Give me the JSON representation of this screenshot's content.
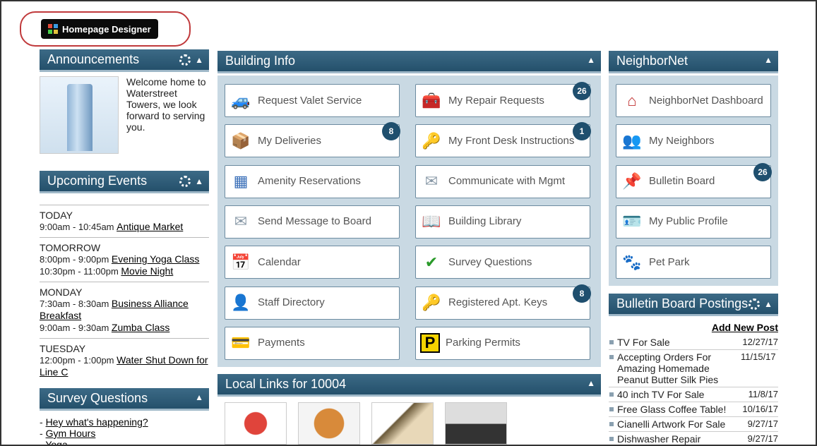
{
  "header": {
    "designer_button": "Homepage Designer"
  },
  "announcements": {
    "title": "Announcements",
    "text": "Welcome home to Waterstreet Towers, we look forward to serving you."
  },
  "events": {
    "title": "Upcoming Events",
    "days": [
      {
        "day": "TODAY",
        "items": [
          {
            "time": "9:00am - 10:45am",
            "name": "Antique Market"
          }
        ]
      },
      {
        "day": "TOMORROW",
        "items": [
          {
            "time": "8:00pm - 9:00pm",
            "name": "Evening Yoga Class"
          },
          {
            "time": "10:30pm - 11:00pm",
            "name": "Movie Night"
          }
        ]
      },
      {
        "day": "MONDAY",
        "items": [
          {
            "time": "7:30am - 8:30am",
            "name": "Business Alliance Breakfast"
          },
          {
            "time": "9:00am - 9:30am",
            "name": "Zumba Class"
          }
        ]
      },
      {
        "day": "TUESDAY",
        "items": [
          {
            "time": "12:00pm - 1:00pm",
            "name": "Water Shut Down for Line C"
          }
        ]
      }
    ]
  },
  "survey": {
    "title": "Survey Questions",
    "items": [
      "Hey what's happening?",
      "Gym Hours",
      "Yoga"
    ]
  },
  "building": {
    "title": "Building Info",
    "tiles": [
      {
        "label": "Request Valet Service",
        "icon": "car-icon",
        "badge": ""
      },
      {
        "label": "My Repair Requests",
        "icon": "toolbox-icon",
        "badge": "26"
      },
      {
        "label": "My Deliveries",
        "icon": "package-icon",
        "badge": "8"
      },
      {
        "label": "My Front Desk Instructions",
        "icon": "key-icon",
        "badge": "1"
      },
      {
        "label": "Amenity Reservations",
        "icon": "calendar-grid-icon",
        "badge": ""
      },
      {
        "label": "Communicate with Mgmt",
        "icon": "envelope-icon",
        "badge": ""
      },
      {
        "label": "Send Message to Board",
        "icon": "envelope-icon",
        "badge": ""
      },
      {
        "label": "Building Library",
        "icon": "book-icon",
        "badge": ""
      },
      {
        "label": "Calendar",
        "icon": "calendar-icon",
        "badge": ""
      },
      {
        "label": "Survey Questions",
        "icon": "checkmark-icon",
        "badge": ""
      },
      {
        "label": "Staff Directory",
        "icon": "person-icon",
        "badge": ""
      },
      {
        "label": "Registered Apt. Keys",
        "icon": "key-icon",
        "badge": "8"
      },
      {
        "label": "Payments",
        "icon": "credit-card-icon",
        "badge": ""
      },
      {
        "label": "Parking Permits",
        "icon": "parking-icon",
        "badge": ""
      }
    ]
  },
  "locallinks": {
    "title": "Local Links for 10004"
  },
  "neighbornet": {
    "title": "NeighborNet",
    "tiles": [
      {
        "label": "NeighborNet Dashboard",
        "icon": "house-icon",
        "badge": ""
      },
      {
        "label": "My Neighbors",
        "icon": "people-icon",
        "badge": ""
      },
      {
        "label": "Bulletin Board",
        "icon": "pushpin-icon",
        "badge": "26"
      },
      {
        "label": "My Public Profile",
        "icon": "profile-card-icon",
        "badge": ""
      },
      {
        "label": "Pet Park",
        "icon": "paw-icon",
        "badge": ""
      }
    ]
  },
  "bulletin": {
    "title": "Bulletin Board Postings",
    "add_label": "Add New Post",
    "posts": [
      {
        "title": "TV For Sale",
        "date": "12/27/17"
      },
      {
        "title": "Accepting Orders For Amazing Homemade Peanut Butter Silk Pies",
        "date": "11/15/17"
      },
      {
        "title": "40 inch TV For Sale",
        "date": "11/8/17"
      },
      {
        "title": "Free Glass Coffee Table!",
        "date": "10/16/17"
      },
      {
        "title": "Cianelli Artwork For Sale",
        "date": "9/27/17"
      },
      {
        "title": "Dishwasher Repair",
        "date": "9/27/17"
      }
    ]
  }
}
